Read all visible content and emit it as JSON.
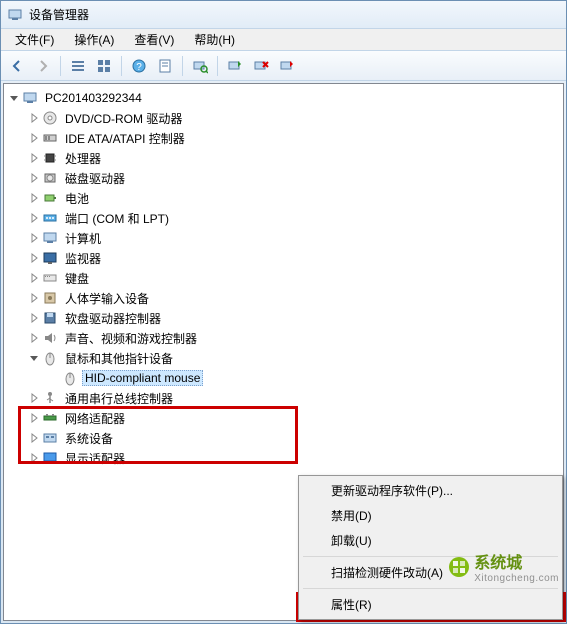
{
  "window": {
    "title": "设备管理器"
  },
  "menubar": {
    "file": "文件(F)",
    "action": "操作(A)",
    "view": "查看(V)",
    "help": "帮助(H)"
  },
  "root": {
    "name": "PC201403292344"
  },
  "categories": [
    {
      "icon": "dvd",
      "label": "DVD/CD-ROM 驱动器"
    },
    {
      "icon": "ide",
      "label": "IDE ATA/ATAPI 控制器"
    },
    {
      "icon": "cpu",
      "label": "处理器"
    },
    {
      "icon": "disk",
      "label": "磁盘驱动器"
    },
    {
      "icon": "battery",
      "label": "电池"
    },
    {
      "icon": "port",
      "label": "端口 (COM 和 LPT)"
    },
    {
      "icon": "computer",
      "label": "计算机"
    },
    {
      "icon": "monitor",
      "label": "监视器"
    },
    {
      "icon": "keyboard",
      "label": "键盘"
    },
    {
      "icon": "hid",
      "label": "人体学输入设备"
    },
    {
      "icon": "floppy",
      "label": "软盘驱动器控制器"
    },
    {
      "icon": "sound",
      "label": "声音、视频和游戏控制器"
    },
    {
      "icon": "mouse",
      "label": "鼠标和其他指针设备",
      "expanded": true,
      "children": [
        {
          "icon": "mouse",
          "label": "HID-compliant mouse",
          "selected": true
        }
      ]
    },
    {
      "icon": "usb",
      "label": "通用串行总线控制器"
    },
    {
      "icon": "network",
      "label": "网络适配器"
    },
    {
      "icon": "system",
      "label": "系统设备"
    },
    {
      "icon": "display",
      "label": "显示适配器"
    }
  ],
  "context_menu": {
    "update_driver": "更新驱动程序软件(P)...",
    "disable": "禁用(D)",
    "uninstall": "卸载(U)",
    "scan": "扫描检测硬件改动(A)",
    "properties": "属性(R)"
  },
  "watermark": {
    "brand": "系统城",
    "url": "Xitongcheng.com"
  }
}
